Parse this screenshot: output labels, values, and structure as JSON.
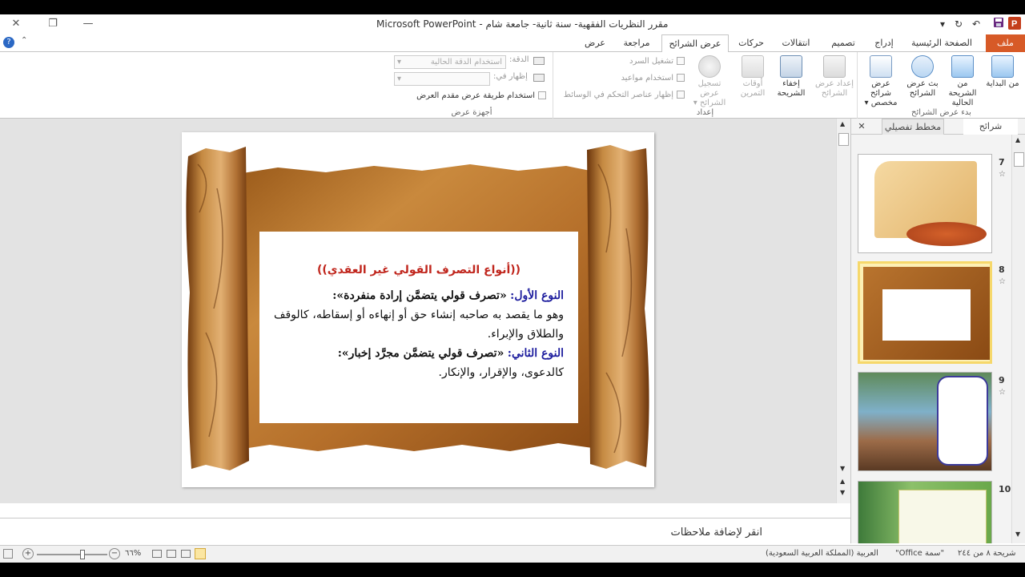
{
  "window": {
    "title": "مقرر النظريات الفقهية- سنة ثانية- جامعة شام  -  Microsoft PowerPoint",
    "controls": {
      "close": "✕",
      "restore": "❐",
      "minimize": "—"
    }
  },
  "tabs": [
    "ملف",
    "الصفحة الرئيسية",
    "إدراج",
    "تصميم",
    "انتقالات",
    "حركات",
    "عرض الشرائح",
    "مراجعة",
    "عرض"
  ],
  "ribbon": {
    "start_group": {
      "label": "بدء عرض الشرائح",
      "buttons": [
        {
          "label": "من البداية"
        },
        {
          "label": "من الشريحة الحالية"
        },
        {
          "label": "بث عرض الشرائح"
        },
        {
          "label": "عرض شرائح مخصص ▾"
        }
      ]
    },
    "setup_group": {
      "label": "إعداد",
      "buttons": [
        {
          "label": "إعداد عرض الشرائح"
        },
        {
          "label": "إخفاء الشريحة"
        },
        {
          "label": "أوقات التمرين"
        },
        {
          "label": "تسجيل عرض الشرائح ▾"
        }
      ],
      "checkboxes": [
        "تشغيل السرد",
        "استخدام مواعيد",
        "إظهار عناصر التحكم في الوسائط"
      ]
    },
    "monitors_group": {
      "label": "أجهزة عرض",
      "resolution_label": "الدقة:",
      "resolution_value": "استخدام الدقة الحالية",
      "show_on_label": "إظهار في:",
      "show_on_value": "",
      "presenter_view": "استخدام طريقة عرض مقدم العرض"
    }
  },
  "pane": {
    "tab_slides": "شرائح",
    "tab_outline": "مخطط تفصيلي",
    "close": "✕",
    "thumbnails": [
      {
        "number": "7",
        "star": "☆"
      },
      {
        "number": "8",
        "star": "☆"
      },
      {
        "number": "9",
        "star": "☆"
      },
      {
        "number": "10",
        "star": ""
      }
    ]
  },
  "slide": {
    "title": "((أنواع التصرف القولي غير العقدي))",
    "type1_label": "النوع الأول:",
    "type1_heading": "«تصرف قولي يتضمَّن إرادة منفردة»:",
    "type1_body": "وهو ما يقصد به صاحبه إنشاء حق أو إنهاءه أو إسقاطه، كالوقف والطلاق والإبراء.",
    "type2_label": "النوع الثاني:",
    "type2_heading": "«تصرف قولي يتضمَّن مجرَّد إخبار»:",
    "type2_body": "كالدعوى، والإقرار، والإنكار."
  },
  "notes": {
    "placeholder": "انقر لإضافة ملاحظات"
  },
  "status": {
    "slide_position": "شريحة ٨ من ٢٤٤",
    "theme": "\"سمة Office\"",
    "language": "العربية (المملكة العربية السعودية)",
    "zoom": "%٦٦"
  },
  "colors": {
    "file_tab": "#d75a27",
    "accent": "#2b579a",
    "slide_title": "#c0261d",
    "type_label": "#1d1d9e",
    "selected_thumb": "#f6d86b"
  }
}
